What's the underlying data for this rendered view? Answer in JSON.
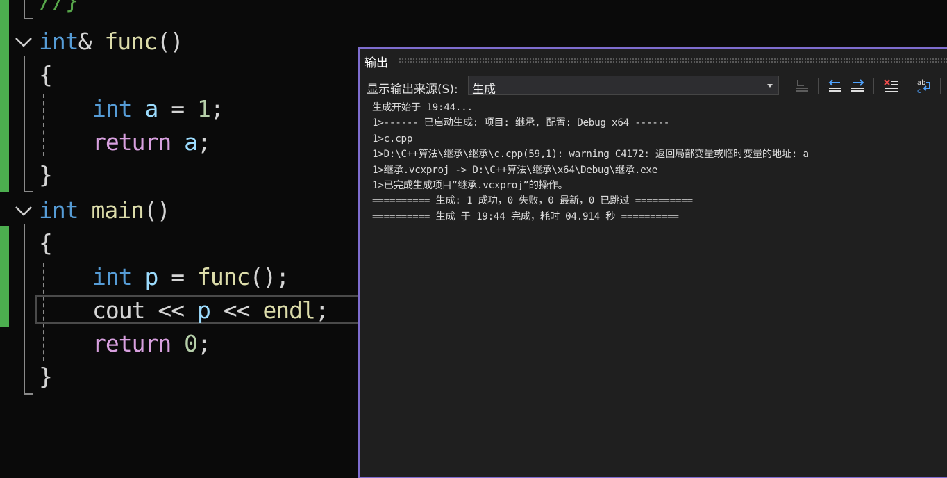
{
  "editor": {
    "lines": [
      {
        "tokens": [
          {
            "t": "//}",
            "c": "cm"
          }
        ]
      },
      {
        "tokens": [
          {
            "t": "int",
            "c": "kw"
          },
          {
            "t": "& ",
            "c": "pn"
          },
          {
            "t": "func",
            "c": "fn"
          },
          {
            "t": "()",
            "c": "pn"
          }
        ]
      },
      {
        "tokens": [
          {
            "t": "{",
            "c": "pn"
          }
        ]
      },
      {
        "tokens": [
          {
            "t": "int",
            "c": "kw"
          },
          {
            "t": " ",
            "c": "pn"
          },
          {
            "t": "a",
            "c": "var"
          },
          {
            "t": " = ",
            "c": "pn"
          },
          {
            "t": "1",
            "c": "num"
          },
          {
            "t": ";",
            "c": "pn"
          }
        ]
      },
      {
        "tokens": [
          {
            "t": "return",
            "c": "ctl"
          },
          {
            "t": " ",
            "c": "pn"
          },
          {
            "t": "a",
            "c": "var"
          },
          {
            "t": ";",
            "c": "pn"
          }
        ]
      },
      {
        "tokens": [
          {
            "t": "}",
            "c": "pn"
          }
        ]
      },
      {
        "tokens": [
          {
            "t": "int",
            "c": "kw"
          },
          {
            "t": " ",
            "c": "pn"
          },
          {
            "t": "main",
            "c": "fn"
          },
          {
            "t": "()",
            "c": "pn"
          }
        ]
      },
      {
        "tokens": [
          {
            "t": "{",
            "c": "pn"
          }
        ]
      },
      {
        "tokens": [
          {
            "t": "int",
            "c": "kw"
          },
          {
            "t": " ",
            "c": "pn"
          },
          {
            "t": "p",
            "c": "var"
          },
          {
            "t": " = ",
            "c": "pn"
          },
          {
            "t": "func",
            "c": "fn"
          },
          {
            "t": "();",
            "c": "pn"
          }
        ]
      },
      {
        "tokens": [
          {
            "t": "cout",
            "c": "pn"
          },
          {
            "t": " << ",
            "c": "pn"
          },
          {
            "t": "p",
            "c": "var"
          },
          {
            "t": " << ",
            "c": "pn"
          },
          {
            "t": "endl",
            "c": "fn"
          },
          {
            "t": ";",
            "c": "pn"
          }
        ]
      },
      {
        "tokens": [
          {
            "t": "return",
            "c": "ctl"
          },
          {
            "t": " ",
            "c": "pn"
          },
          {
            "t": "0",
            "c": "num"
          },
          {
            "t": ";",
            "c": "pn"
          }
        ]
      },
      {
        "tokens": [
          {
            "t": "}",
            "c": "pn"
          }
        ]
      }
    ]
  },
  "output_panel": {
    "title": "输出",
    "source_label": "显示输出来源(S):",
    "source_value": "生成",
    "lines": [
      "生成开始于 19:44...",
      "1>------ 已启动生成: 项目: 继承, 配置: Debug x64 ------",
      "1>c.cpp",
      "1>D:\\C++算法\\继承\\继承\\c.cpp(59,1): warning C4172: 返回局部变量或临时变量的地址: a",
      "1>继承.vcxproj -> D:\\C++算法\\继承\\x64\\Debug\\继承.exe",
      "1>已完成生成项目“继承.vcxproj”的操作。",
      "========== 生成: 1 成功，0 失败，0 最新，0 已跳过 ==========",
      "========== 生成 于 19:44 完成，耗时 04.914 秒 =========="
    ]
  },
  "colors": {
    "keyword": "#569cd6",
    "function": "#dcdcaa",
    "variable": "#9cdcfe",
    "control": "#d8a0df",
    "number": "#b5cea8",
    "comment": "#57a64a",
    "change_bar": "#4cae4f",
    "panel_border": "#7e6dcf"
  },
  "icons": [
    "collapse-chevron-icon",
    "word-wrap-disabled-icon",
    "unindent-icon",
    "indent-icon",
    "clear-all-icon",
    "word-wrap-toggle-icon",
    "dropdown-arrow-icon"
  ]
}
